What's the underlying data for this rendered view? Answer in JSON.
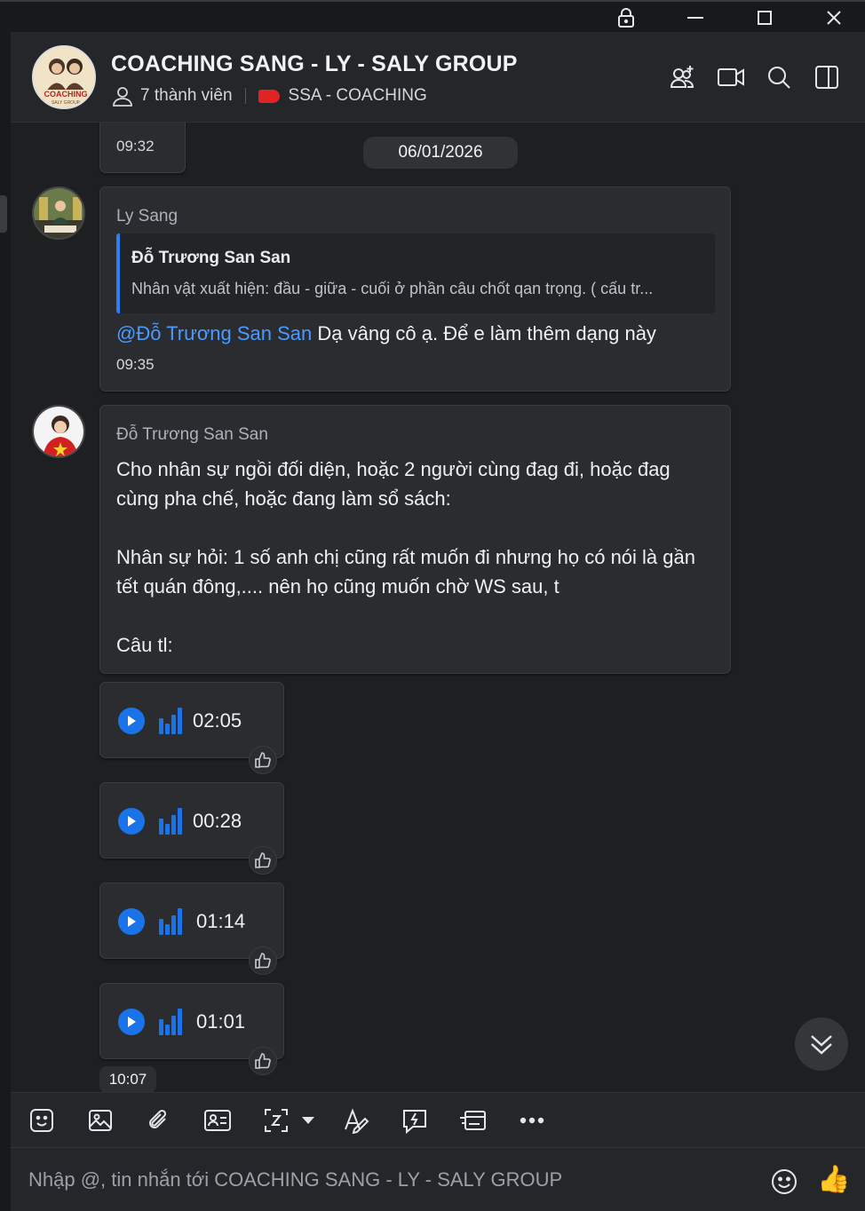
{
  "window": {
    "controls": [
      "lock-icon",
      "minimize-icon",
      "maximize-icon",
      "close-icon"
    ]
  },
  "header": {
    "title": "COACHING SANG - LY - SALY GROUP",
    "members": "7 thành viên",
    "tag_label": "SSA - COACHING",
    "tag_color": "#e02424",
    "avatar_text": "COACHING",
    "avatar_subtext": "SALY GROUP",
    "actions": [
      "add-member-icon",
      "video-call-icon",
      "search-icon",
      "sidebar-toggle-icon"
    ]
  },
  "chat": {
    "prev_time": "09:32",
    "date_separator": "06/01/2026",
    "messages": [
      {
        "sender": "Ly Sang",
        "quote_name": "Đỗ Trương San San",
        "quote_text": "Nhân vật xuất hiện: đầu - giữa - cuối ở phần câu chốt qan trọng. ( cấu tr...",
        "mention": "@Đỗ Trương San San",
        "text": " Dạ vâng cô ạ. Để e làm thêm dạng này",
        "time": "09:35"
      },
      {
        "sender": "Đỗ Trương San San",
        "line1": "Cho nhân sự ngồi đối diện, hoặc 2 người cùng đag đi, hoặc đag",
        "line2": "cùng pha chế, hoặc đang làm sổ sách:",
        "line3": "Nhân sự hỏi: 1 số anh chị cũng rất muốn đi nhưng họ có nói là gần",
        "line4": "tết quán đông,.... nên họ cũng muốn chờ WS sau, t",
        "line5": "Câu tl:"
      }
    ],
    "voice_messages": [
      {
        "duration": "02:05"
      },
      {
        "duration": "00:28"
      },
      {
        "duration": "01:14"
      },
      {
        "duration": "01:01"
      }
    ],
    "last_time": "10:07"
  },
  "toolbar": {
    "tools": [
      "sticker-icon",
      "image-icon",
      "attachment-icon",
      "contact-card-icon",
      "screenshot-icon",
      "dropdown-icon",
      "text-format-icon",
      "quick-message-icon",
      "todo-icon",
      "more-icon"
    ]
  },
  "input": {
    "placeholder": "Nhập @, tin nhắn tới COACHING SANG - LY - SALY GROUP",
    "like_emoji": "👍"
  },
  "colors": {
    "accent": "#1a73e8",
    "mention": "#4a9bff",
    "background": "#1e1f21",
    "bubble": "#2b2c30"
  }
}
